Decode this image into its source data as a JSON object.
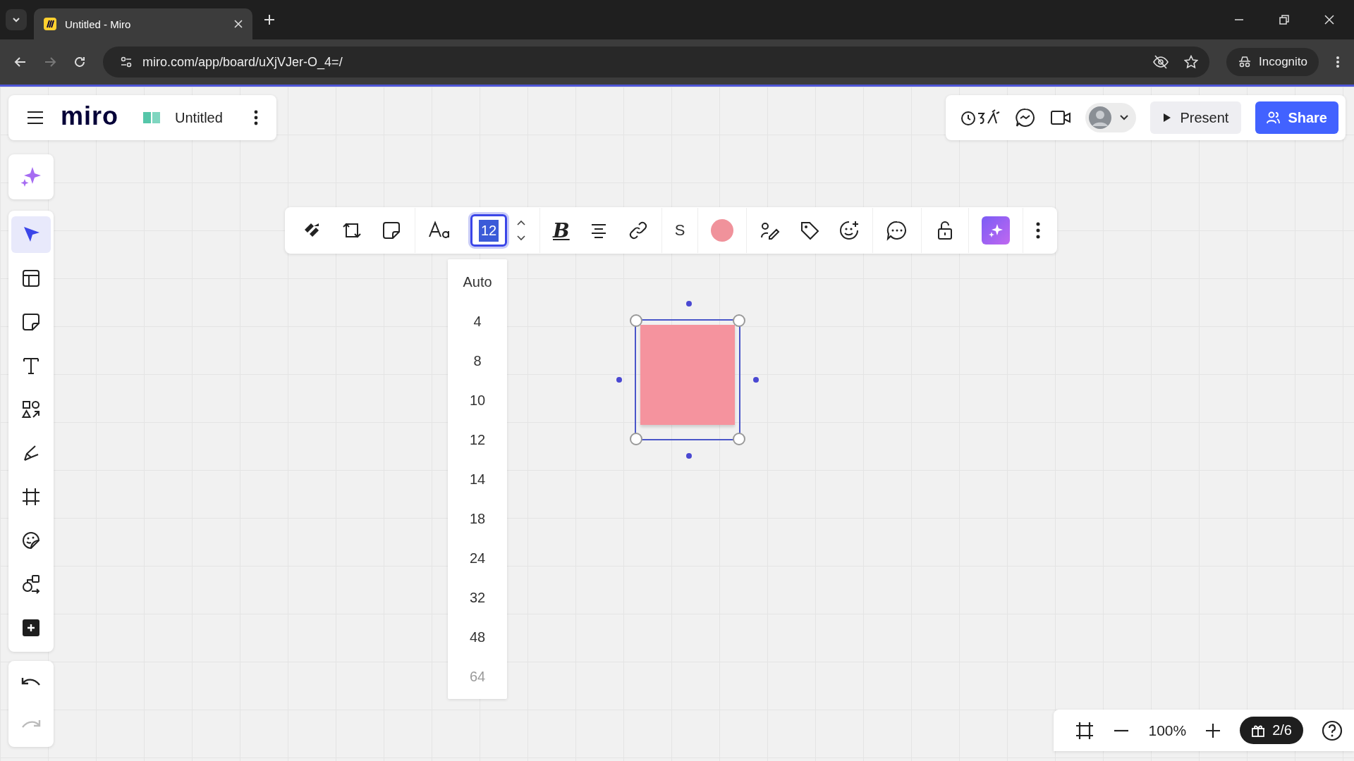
{
  "browser": {
    "tabs": [
      {
        "title": "Untitled - Miro",
        "selected": true
      }
    ],
    "url": "miro.com/app/board/uXjVJer-O_4=/",
    "profile": "Incognito"
  },
  "board_header": {
    "logo": "miro",
    "title": "Untitled"
  },
  "top_actions": {
    "present": "Present",
    "share": "Share"
  },
  "left_tools": [
    {
      "kind": "select",
      "selected": true
    },
    {
      "kind": "templates",
      "selected": false
    },
    {
      "kind": "sticky",
      "selected": false
    },
    {
      "kind": "text",
      "selected": false
    },
    {
      "kind": "shapes",
      "selected": false
    },
    {
      "kind": "pen",
      "selected": false
    },
    {
      "kind": "frame",
      "selected": false
    },
    {
      "kind": "stickers",
      "selected": false
    },
    {
      "kind": "diagram",
      "selected": false
    },
    {
      "kind": "add",
      "selected": false
    }
  ],
  "format_toolbar": {
    "font_size": "12",
    "bold_glyph": "B",
    "font_glyph": "S"
  },
  "font_size_menu": [
    {
      "label": "Auto",
      "faded": false
    },
    {
      "label": "4",
      "faded": false
    },
    {
      "label": "8",
      "faded": false
    },
    {
      "label": "10",
      "faded": false
    },
    {
      "label": "12",
      "faded": false
    },
    {
      "label": "14",
      "faded": false
    },
    {
      "label": "18",
      "faded": false
    },
    {
      "label": "24",
      "faded": false
    },
    {
      "label": "32",
      "faded": false
    },
    {
      "label": "48",
      "faded": false
    },
    {
      "label": "64",
      "faded": true
    }
  ],
  "bottom_bar": {
    "zoom": "100%",
    "pages": "2/6"
  }
}
